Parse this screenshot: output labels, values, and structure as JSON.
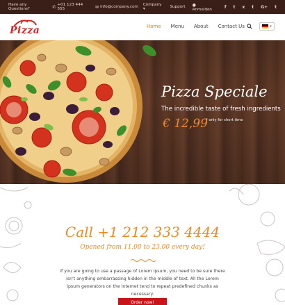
{
  "topbar": {
    "question": "Have any Questions?",
    "phone": "+01 123 444 555",
    "email": "info@company.com",
    "company_menu": "Company",
    "support": "Support",
    "login": "Anmelden",
    "social": [
      "f",
      "t",
      "x",
      "t",
      "G+",
      "t"
    ]
  },
  "header": {
    "logo_text": "Pizza",
    "nav": [
      "Home",
      "Menu",
      "About",
      "Contact Us"
    ],
    "lang_flag": "de"
  },
  "hero": {
    "title": "Pizza Speciale",
    "subtitle": "The incredible taste of fresh ingredients",
    "price": "€ 12,99",
    "price_note": "* only for short time"
  },
  "content": {
    "call": "Call +1 212 333 4444",
    "open": "Opened from 11.00 to 23.00 every day!",
    "paragraph": "If you are going to use a passage of Lorem Ipsum, you need to be sure there isn't anything embarrassing hidden in the middle of text. All the Lorem Ipsum generators on the Internet tend to repeat predefined chunks as necessary.",
    "order_button": "Order now!"
  },
  "colors": {
    "accent": "#ef8a23",
    "brand_red": "#d42525",
    "topbar_bg": "#3a1f18"
  }
}
